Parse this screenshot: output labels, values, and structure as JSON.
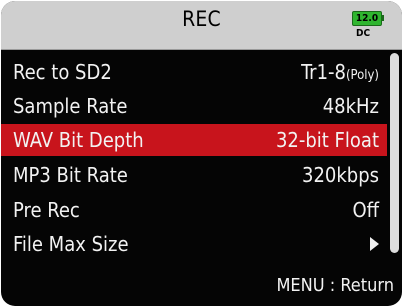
{
  "header": {
    "title": "REC",
    "battery_value": "12.0",
    "power_source": "DC"
  },
  "menu": {
    "items": [
      {
        "label": "Rec to SD2",
        "value": "Tr1-8",
        "value_suffix": "(Poly)"
      },
      {
        "label": "Sample Rate",
        "value": "48kHz"
      },
      {
        "label": "WAV Bit Depth",
        "value": "32-bit Float",
        "selected": true
      },
      {
        "label": "MP3 Bit Rate",
        "value": "320kbps"
      },
      {
        "label": "Pre Rec",
        "value": "Off"
      },
      {
        "label": "File Max Size",
        "value_icon": "arrow-right-icon"
      }
    ]
  },
  "footer": {
    "hint": "MENU : Return"
  },
  "colors": {
    "selection": "#c8141c",
    "battery": "#2fb52f",
    "background": "#050505",
    "title_bar": "#cfcfcf"
  }
}
